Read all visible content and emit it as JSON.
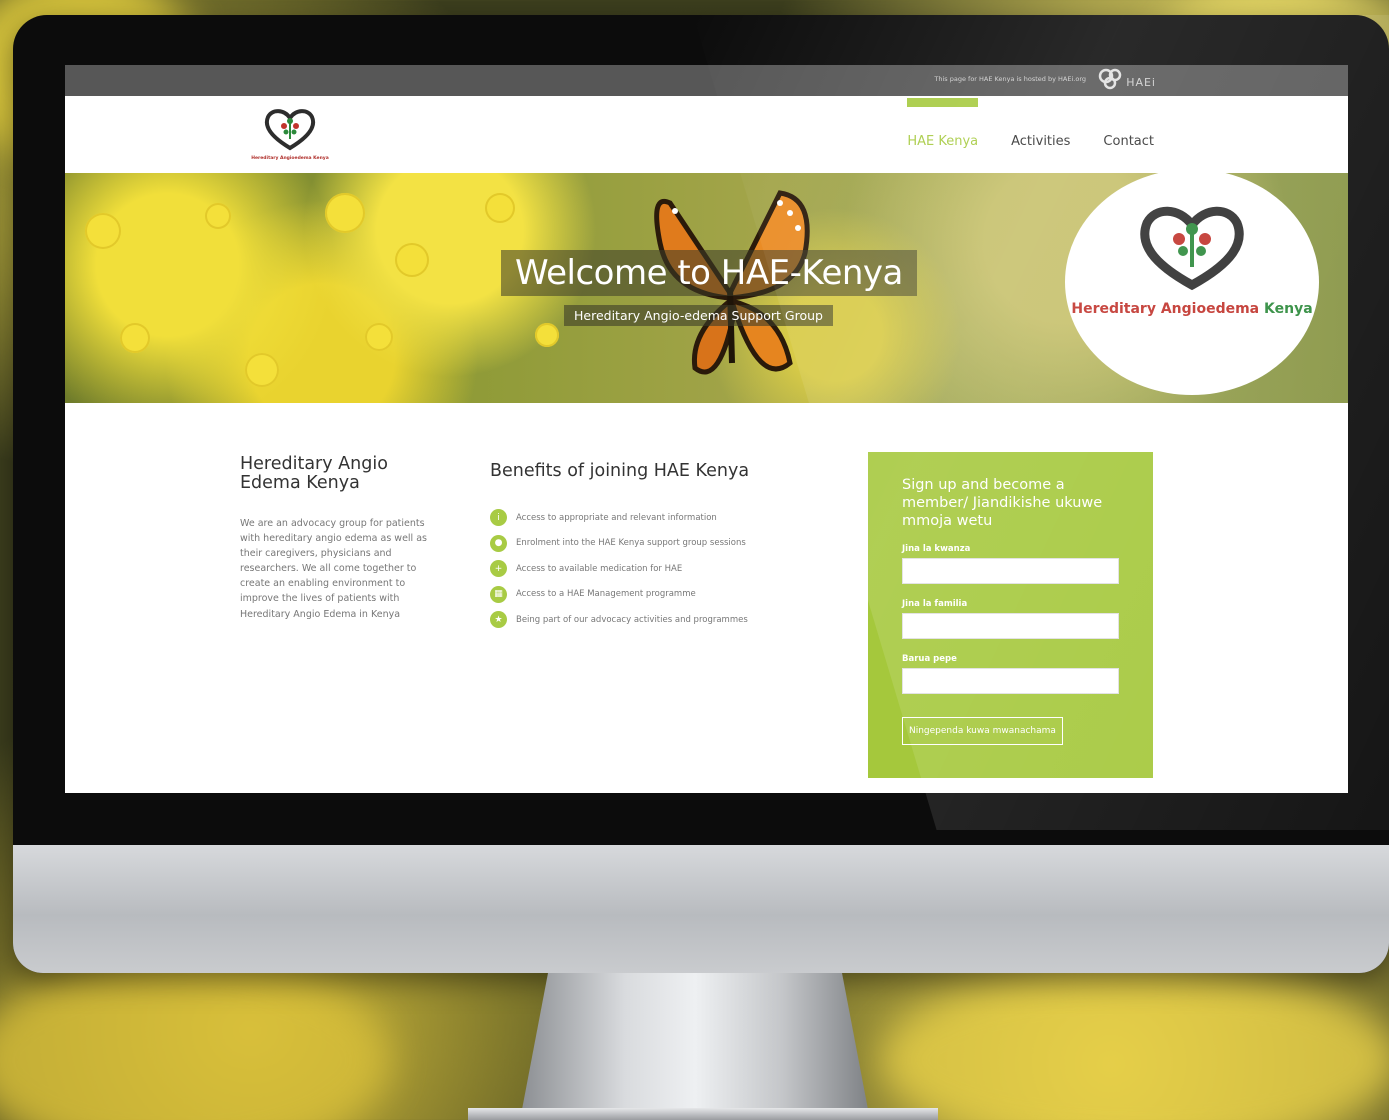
{
  "topbar": {
    "note": "This page for HAE Kenya is hosted by HAEi.org",
    "partner_logo_text": "HAEi"
  },
  "site": {
    "logo_tagline": "Hereditary Angioedema Kenya"
  },
  "nav": {
    "items": [
      {
        "label": "HAE Kenya",
        "active": true
      },
      {
        "label": "Activities",
        "active": false
      },
      {
        "label": "Contact",
        "active": false
      }
    ]
  },
  "hero": {
    "title": "Welcome to HAE-Kenya",
    "subtitle": "Hereditary Angio-edema Support Group",
    "badge_brand_red": "Hereditary Angioedema",
    "badge_brand_green": "Kenya"
  },
  "about": {
    "heading": "Hereditary Angio Edema Kenya",
    "body": "We are an advocacy group for patients with hereditary angio edema as well as their caregivers, physicians and researchers. We all come together to create an enabling environment to improve the lives of patients with Hereditary Angio Edema in Kenya"
  },
  "benefits": {
    "heading": "Benefits of joining HAE Kenya",
    "items": [
      {
        "label": "Access to appropriate and relevant information",
        "icon": "info-icon"
      },
      {
        "label": "Enrolment into the HAE Kenya support group sessions",
        "icon": "group-icon"
      },
      {
        "label": "Access to available medication for HAE",
        "icon": "medication-icon"
      },
      {
        "label": "Access to a HAE Management programme",
        "icon": "calendar-icon"
      },
      {
        "label": "Being part of our advocacy activities and programmes",
        "icon": "star-icon"
      }
    ]
  },
  "signup": {
    "heading": "Sign up and become a member/ Jiandikishe ukuwe mmoja wetu",
    "first_name_label": "Jina la kwanza",
    "first_name_value": "",
    "last_name_label": "Jina la familia",
    "last_name_value": "",
    "email_label": "Barua pepe",
    "email_value": "",
    "submit_label": "Ningependa kuwa mwanachama"
  },
  "colors": {
    "accent": "#a8cb44",
    "brand_red": "#c1332c",
    "brand_green": "#2c8a3b",
    "topbar": "#575757"
  }
}
